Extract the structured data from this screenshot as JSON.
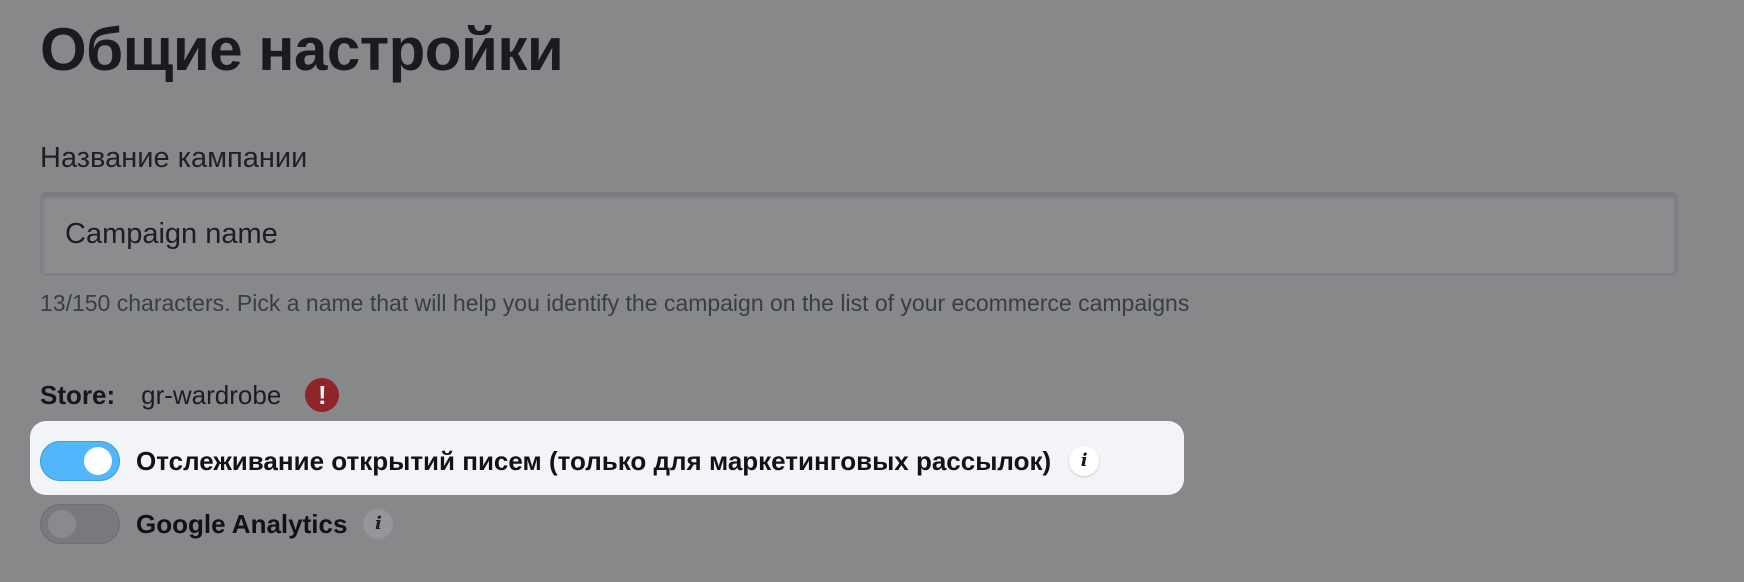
{
  "page": {
    "title": "Общие настройки"
  },
  "campaign_name": {
    "label": "Название кампании",
    "value": "Campaign name",
    "placeholder": "",
    "helper": "13/150 characters. Pick a name that will help you identify the campaign on the list of your ecommerce campaigns"
  },
  "store": {
    "label": "Store:",
    "value": "gr-wardrobe",
    "alert_icon": "exclamation-icon",
    "alert_glyph": "!"
  },
  "toggles": [
    {
      "label": "Отслеживание открытий писем (только для маркетинговых рассылок)",
      "enabled": true,
      "info_icon": "info-icon",
      "info_glyph": "i"
    },
    {
      "label": "Google Analytics",
      "enabled": false,
      "info_icon": "info-icon",
      "info_glyph": "i"
    }
  ],
  "colors": {
    "overlay_background": "#87888a",
    "toggle_on": "#52b6fb",
    "alert": "#8f2528",
    "highlight": "#f3f4f7"
  }
}
